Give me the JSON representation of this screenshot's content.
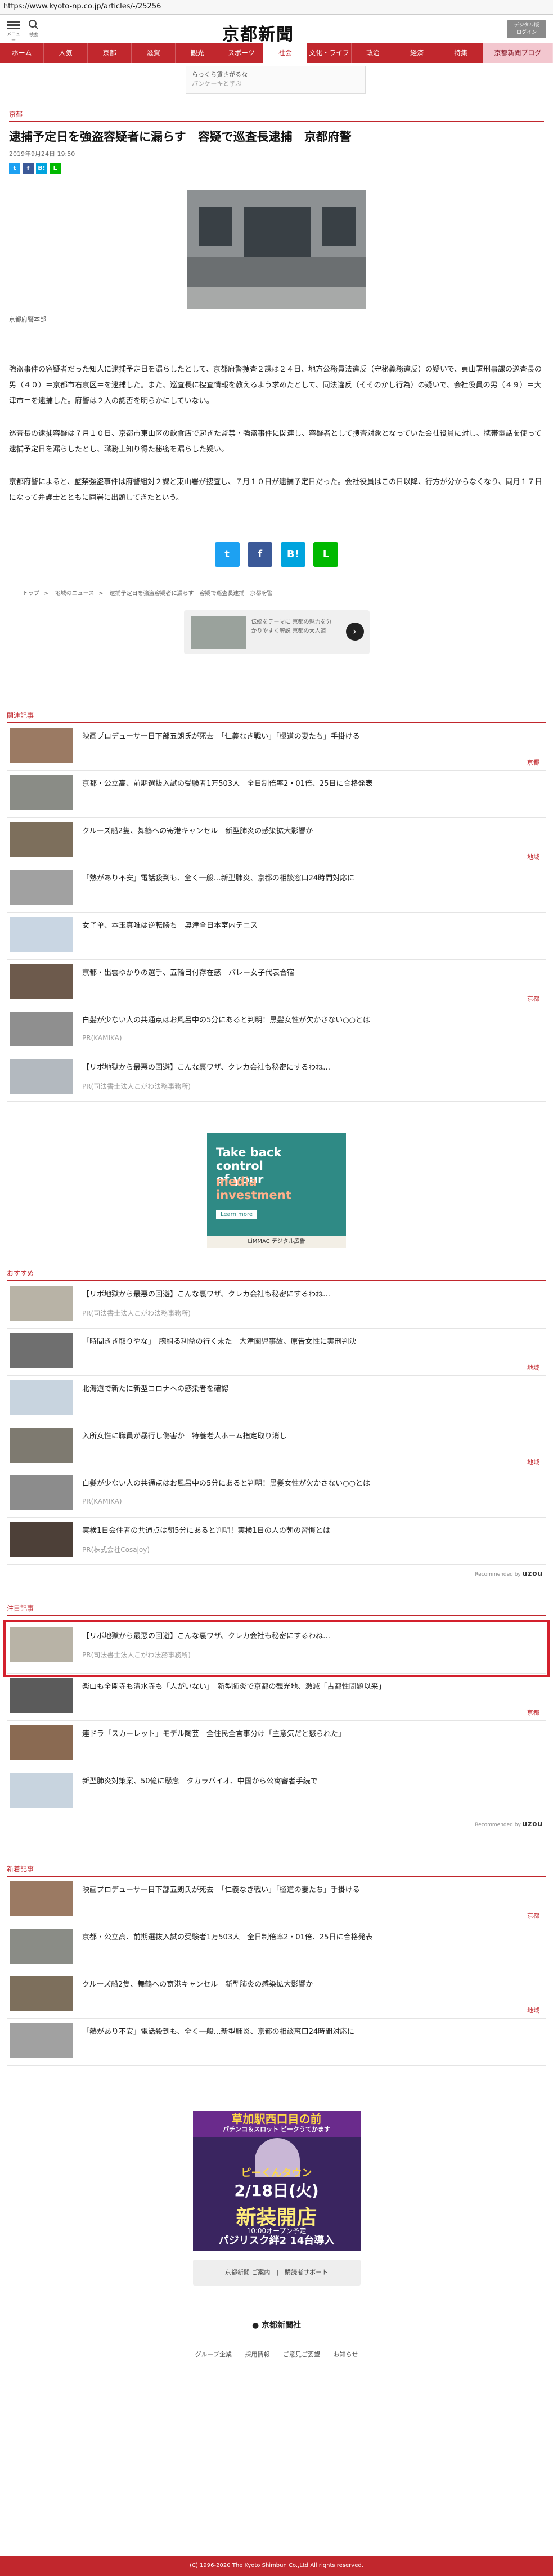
{
  "url": "https://www.kyoto-np.co.jp/articles/-/25256",
  "header": {
    "menu_caption": "メニュー",
    "search_caption": "検索",
    "logo": "京都新聞",
    "premium_line1": "デジタル版",
    "premium_line2": "ログイン"
  },
  "nav": [
    "ホーム",
    "人気",
    "京都",
    "滋賀",
    "観光",
    "スポーツ",
    "社会",
    "文化・ライフ",
    "政治",
    "経済",
    "特集",
    "京都新聞ブログ"
  ],
  "nav_active_index": 6,
  "banner": {
    "line1": "らっくら賃さがるな",
    "line2": "パンケーキと学ぶ"
  },
  "article": {
    "category": "京都",
    "headline": "逮捕予定日を強盗容疑者に漏らす　容疑で巡査長逮捕　京都府警",
    "date": "2019年9月24日 19:50",
    "photo_caption": "京都府警本部",
    "paragraphs": [
      "強盗事件の容疑者だった知人に逮捕予定日を漏らしたとして、京都府警捜査２課は２４日、地方公務員法違反（守秘義務違反）の疑いで、東山署刑事課の巡査長の男（４０）＝京都市右京区＝を逮捕した。また、巡査長に捜査情報を教えるよう求めたとして、同法違反（そそのかし行為）の疑いで、会社役員の男（４９）＝大津市＝を逮捕した。府警は２人の認否を明らかにしていない。",
      "巡査長の逮捕容疑は７月１０日、京都市東山区の飲食店で起きた監禁・強盗事件に関連し、容疑者として捜査対象となっていた会社役員に対し、携帯電話を使って逮捕予定日を漏らしたとし、職務上知り得た秘密を漏らした疑い。",
      "京都府警によると、監禁強盗事件は府警組対２課と東山署が捜査し、７月１０日が逮捕予定日だった。会社役員はこの日以降、行方が分からなくなり、同月１７日になって弁護士とともに同署に出頭してきたという。"
    ]
  },
  "share": {
    "small": [
      "t",
      "f",
      "B!",
      "L"
    ],
    "large": [
      "t",
      "f",
      "B!",
      "L"
    ]
  },
  "breadcrumb": [
    "トップ",
    "地域のニュース",
    "逮捕予定日を強盗容疑者に漏らす　容疑で巡査長逮捕　京都府警"
  ],
  "promo": {
    "text": "伝統をテーマに 京都の魅力を分かりやすく解説 京都の大人道"
  },
  "related": {
    "title": "関連記事",
    "items": [
      {
        "title": "映画プロデューサー日下部五朗氏が死去　「仁義なき戦い」「極道の妻たち」手掛ける",
        "tag": "京都",
        "sponsor": ""
      },
      {
        "title": "京都・公立高、前期選抜入試の受験者1万503人　全日制倍率2・01倍、25日に合格発表",
        "tag": "",
        "sponsor": ""
      },
      {
        "title": "クルーズ船2隻、舞鶴への寄港キャンセル　新型肺炎の感染拡大影響か",
        "tag": "地域",
        "sponsor": ""
      },
      {
        "title": "「熱があり不安」電話殺到も、全く一般…新型肺炎、京都の相談窓口24時間対応に",
        "tag": "",
        "sponsor": ""
      },
      {
        "title": "女子单、本玉真唯は逆転勝ち　奥津全日本室内テニス",
        "tag": "",
        "sponsor": ""
      },
      {
        "title": "京都・出雲ゆかりの選手、五輪目付存在感　バレー女子代表合宿",
        "tag": "京都",
        "sponsor": ""
      },
      {
        "title": "白髪が少ない人の共通点はお風呂中の5分にあると判明！黒髪女性が欠かさない○○とは",
        "tag": "",
        "sponsor": "PR(KAMIKA)"
      },
      {
        "title": "【リボ地獄から最悪の回避】こんな裏ワザ、クレカ会社も秘密にするわね…",
        "tag": "",
        "sponsor": "PR(司法書士法人こがわ法務事務所)"
      }
    ]
  },
  "ad1": {
    "line1": "Take back control",
    "line2": "of your",
    "line3": "media investment",
    "cta": "Learn more",
    "foot": "LiMMAC  デジタル広告"
  },
  "recommend": {
    "title": "おすすめ",
    "items": [
      {
        "title": "【リボ地獄から最悪の回避】こんな裏ワザ、クレカ会社も秘密にするわね…",
        "tag": "",
        "sponsor": "PR(司法書士法人こがわ法務事務所)"
      },
      {
        "title": "「時間きき取りやな」　腕組る利益の行く末た　大津園児事故、原告女性に実刑判決",
        "tag": "地域",
        "sponsor": ""
      },
      {
        "title": "北海道で新たに新型コロナへの感染者を確認",
        "tag": "",
        "sponsor": ""
      },
      {
        "title": "入所女性に職員が暴行し傷害か　特養老人ホーム指定取り消し",
        "tag": "地域",
        "sponsor": ""
      },
      {
        "title": "白髪が少ない人の共通点はお風呂中の5分にあると判明！黒髪女性が欠かさない○○とは",
        "tag": "",
        "sponsor": "PR(KAMIKA)"
      },
      {
        "title": "実検1日会住者の共通点は朝5分にあると判明！実検1日の人の朝の習慣とは",
        "tag": "",
        "sponsor": "PR(株式会社Cosajoy)"
      }
    ],
    "recommended_by": "Recommended by",
    "brand": "uzou"
  },
  "attention": {
    "title": "注目記事",
    "items": [
      {
        "title": "【リボ地獄から最悪の回避】こんな裏ワザ、クレカ会社も秘密にするわね…",
        "tag": "",
        "sponsor": "PR(司法書士法人こがわ法務事務所)"
      },
      {
        "title": "楽山も全開寺も清水寺も「人がいない」　新型肺炎で京都の観光地、激減「古都性問題以来」",
        "tag": "京都",
        "sponsor": ""
      },
      {
        "title": "連ドラ「スカーレット」モデル陶芸　全住民全言事分け「主意気だと怒られた」",
        "tag": "",
        "sponsor": ""
      },
      {
        "title": "新型肺炎対策案、50億に懸念　タカラバイオ、中国から公寓審者手続で",
        "tag": "",
        "sponsor": ""
      }
    ]
  },
  "latest": {
    "title": "新着記事",
    "items": [
      {
        "title": "映画プロデューサー日下部五朗氏が死去　「仁義なき戦い」「極道の妻たち」手掛ける",
        "tag": "京都"
      },
      {
        "title": "京都・公立高、前期選抜入試の受験者1万503人　全日制倍率2・01倍、25日に合格発表",
        "tag": ""
      },
      {
        "title": "クルーズ船2隻、舞鶴への寄港キャンセル　新型肺炎の感染拡大影響か",
        "tag": "地域"
      },
      {
        "title": "「熱があり不安」電話殺到も、全く一般…新型肺炎、京都の相談窓口24時間対応に",
        "tag": ""
      }
    ]
  },
  "ad2": {
    "top": "草加駅西口目の前",
    "top_small": "パチンコ＆スロット ピークうてかます",
    "name": "ピーくんタウン",
    "date": "2/18日(火)",
    "open": "新装開店",
    "time": "10:00オープン予定",
    "bottom": "パジリスク絆2 14台導入"
  },
  "footer": {
    "links": "京都新聞 ご案内　|　購読者サポート",
    "logo": "京都新聞社",
    "sub": [
      "グループ企業",
      "採用情報",
      "ご意見ご要望",
      "お知らせ"
    ],
    "copyright": "(C) 1996-2020 The Kyoto Shimbun Co.,Ltd All rights reserved."
  },
  "colors": {
    "brand": "#c1272d",
    "highlight": "#d4202d"
  }
}
